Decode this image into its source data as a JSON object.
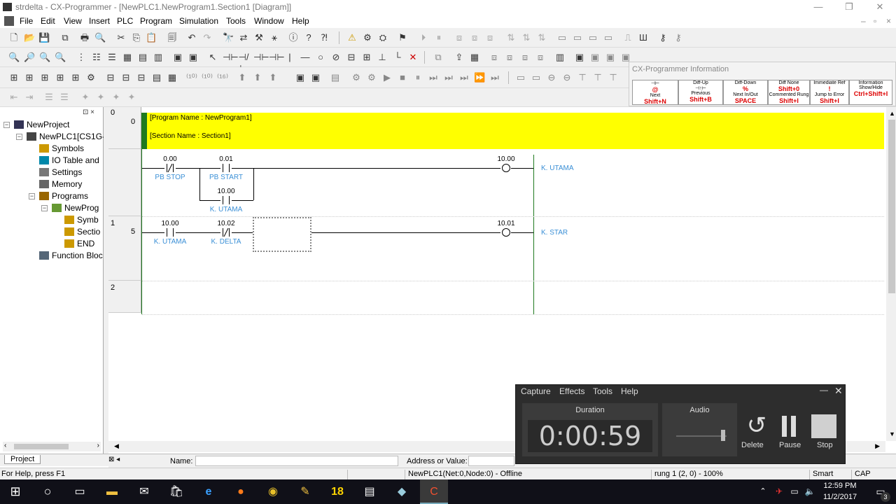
{
  "window": {
    "title": "strdelta - CX-Programmer - [NewPLC1.NewProgram1.Section1 [Diagram]]"
  },
  "menu": [
    "File",
    "Edit",
    "View",
    "Insert",
    "PLC",
    "Program",
    "Simulation",
    "Tools",
    "Window",
    "Help"
  ],
  "info_window": {
    "title": "CX-Programmer Information",
    "keys": [
      {
        "top": "",
        "bottom": "@",
        "sc": "Next",
        "sc2": "Shift+N"
      },
      {
        "top": "Diff-Up",
        "bottom": "",
        "sc": "Previous",
        "sc2": "Shift+B"
      },
      {
        "top": "Diff-Down",
        "bottom": "%",
        "sc": "Next In/Out",
        "sc2": "SPACE"
      },
      {
        "top": "Diff None",
        "bottom": "Shift+0",
        "sc": "Commented Rung",
        "sc2": "Shift+I"
      },
      {
        "top": "Immediate Ref",
        "bottom": "!",
        "sc": "Jump to Error",
        "sc2": "Shift+I"
      },
      {
        "top": "Information",
        "bottom": "Show/Hide",
        "sc": "",
        "sc2": "Ctrl+Shift+I"
      }
    ]
  },
  "tree": {
    "tab": "Project",
    "items": [
      {
        "label": "NewProject",
        "icon": "project-icon"
      },
      {
        "label": "NewPLC1[CS1G-",
        "icon": "plc-icon"
      },
      {
        "label": "Symbols",
        "icon": "symbols-icon"
      },
      {
        "label": "IO Table and",
        "icon": "io-table-icon"
      },
      {
        "label": "Settings",
        "icon": "settings-icon"
      },
      {
        "label": "Memory",
        "icon": "memory-icon"
      },
      {
        "label": "Programs",
        "icon": "programs-icon"
      },
      {
        "label": "NewProg",
        "icon": "program-icon"
      },
      {
        "label": "Symb",
        "icon": "symbols-icon"
      },
      {
        "label": "Sectio",
        "icon": "section-icon"
      },
      {
        "label": "END",
        "icon": "section-icon"
      },
      {
        "label": "Function Bloc",
        "icon": "function-block-icon"
      }
    ]
  },
  "ladder": {
    "program_name": "[Program Name : NewProgram1]",
    "section_name": "[Section Name : Section1]",
    "rung_numbers": [
      "0",
      "1",
      "2"
    ],
    "step_numbers": [
      "0",
      "5"
    ],
    "contacts": [
      {
        "addr": "0.00",
        "comment": "PB STOP",
        "type": "NC"
      },
      {
        "addr": "0.01",
        "comment": "PB START",
        "type": "NO"
      },
      {
        "addr": "10.00",
        "comment": "K. UTAMA",
        "type": "NO"
      },
      {
        "addr": "10.00",
        "comment": "K. UTAMA",
        "type": "NO"
      },
      {
        "addr": "10.02",
        "comment": "K. DELTA",
        "type": "NC"
      }
    ],
    "coils": [
      {
        "addr": "10.00",
        "comment": "K. UTAMA"
      },
      {
        "addr": "10.01",
        "comment": "K. STAR"
      }
    ]
  },
  "bottom": {
    "name_label": "Name:",
    "addr_label": "Address or Value:"
  },
  "status": {
    "help": "For Help, press F1",
    "plc": "NewPLC1(Net:0,Node:0) - Offline",
    "rung": "rung 1 (2, 0) - 100%",
    "mode": "Smart",
    "caps": "CAP"
  },
  "recorder": {
    "menu": [
      "Capture",
      "Effects",
      "Tools",
      "Help"
    ],
    "duration_label": "Duration",
    "audio_label": "Audio",
    "time": "0:00:59",
    "buttons": [
      "Delete",
      "Pause",
      "Stop"
    ]
  },
  "taskbar": {
    "time": "12:59 PM",
    "date": "11/2/2017",
    "badge": "18",
    "notif_count": "3"
  },
  "colors": {
    "banner": "#ffff00",
    "banner_bar": "#1f7a1f",
    "comment": "#3a8fd6",
    "power_rail": "#1f7a1f"
  }
}
